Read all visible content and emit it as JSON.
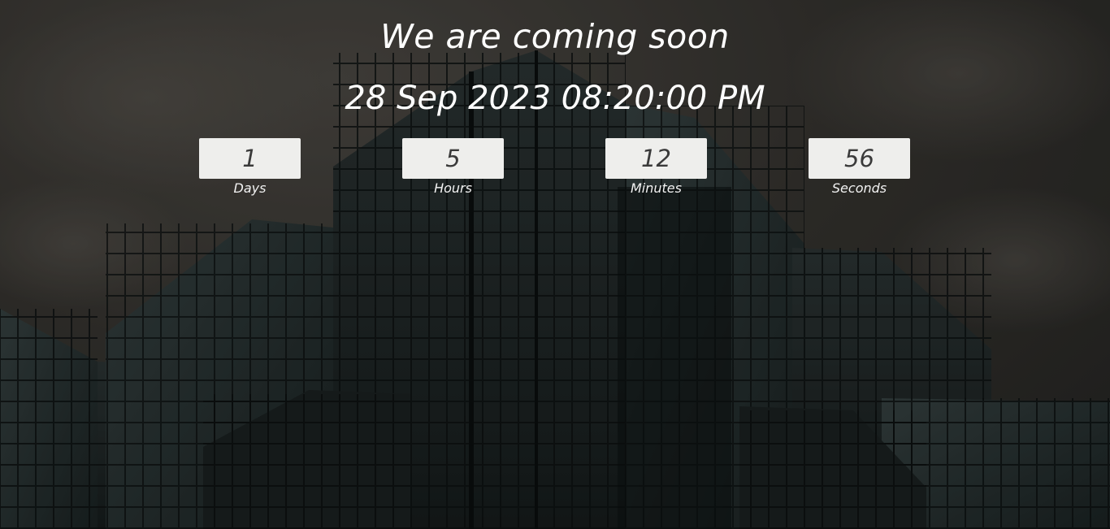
{
  "page": {
    "headline": "We are coming soon",
    "target_date": "28 Sep 2023 08:20:00 PM",
    "background_image": "glass-skyscraper-photo"
  },
  "countdown": [
    {
      "value": "1",
      "label": "Days"
    },
    {
      "value": "5",
      "label": "Hours"
    },
    {
      "value": "12",
      "label": "Minutes"
    },
    {
      "value": "56",
      "label": "Seconds"
    }
  ],
  "colors": {
    "text": "#ffffff",
    "box_bg": "#eeeeec",
    "box_text": "#3a3a3a",
    "sky": "#3f3d39",
    "building": "#1c2424"
  }
}
